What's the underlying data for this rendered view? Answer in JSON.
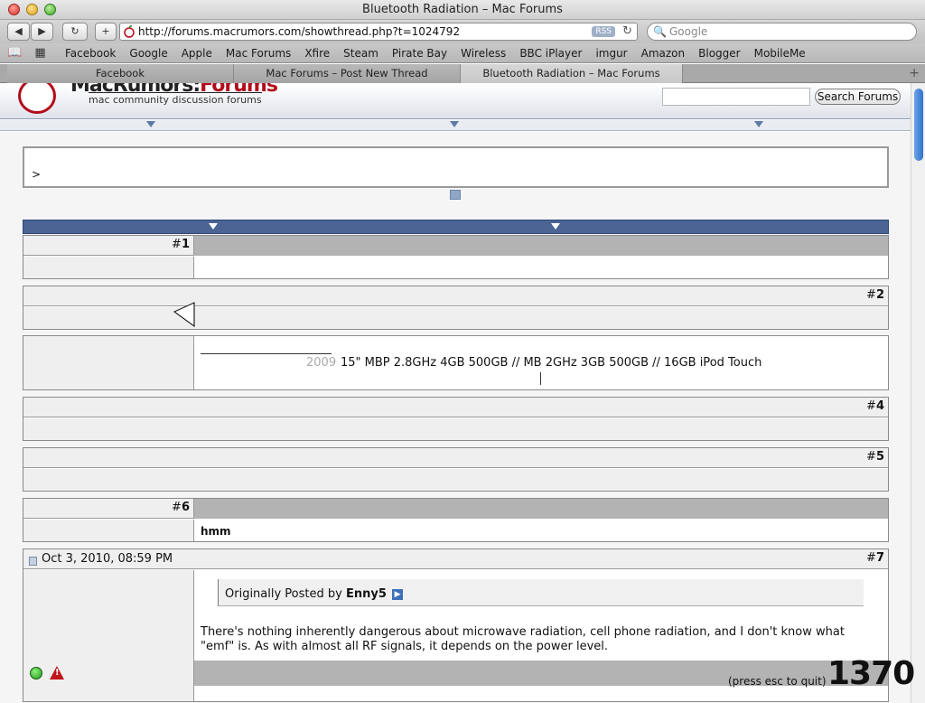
{
  "window": {
    "title": "Bluetooth Radiation – Mac Forums"
  },
  "toolbar": {
    "back_icon": "back-arrow-icon",
    "forward_icon": "forward-arrow-icon",
    "url": "http://forums.macrumors.com/showthread.php?t=1024792",
    "rss_label": "RSS",
    "search_placeholder": "Google"
  },
  "bookmarks": [
    "Facebook",
    "Google",
    "Apple",
    "Mac Forums",
    "Xfire",
    "Steam",
    "Pirate Bay",
    "Wireless",
    "BBC iPlayer",
    "imgur",
    "Amazon",
    "Blogger",
    "MobileMe"
  ],
  "tabs": [
    {
      "label": "Facebook",
      "active": false
    },
    {
      "label": "Mac Forums – Post New Thread",
      "active": false
    },
    {
      "label": "Bluetooth Radiation – Mac Forums",
      "active": true
    }
  ],
  "site": {
    "logo_word": "MacRumors:",
    "logo_word_red": "Forums",
    "tagline": "mac community discussion forums",
    "search_button": "Search Forums"
  },
  "breadcrumb": {
    "text": ">"
  },
  "posts": {
    "p1": {
      "hash": "#",
      "num": "1"
    },
    "p2": {
      "hash": "#",
      "num": "2"
    },
    "p3": {
      "sig_year": "2009",
      "sig_text": "15\" MBP 2.8GHz 4GB 500GB // MB 2GHz 3GB 500GB // 16GB iPod Touch"
    },
    "p4": {
      "hash": "#",
      "num": "4"
    },
    "p5": {
      "hash": "#",
      "num": "5"
    },
    "p6": {
      "hash": "#",
      "num": "6",
      "body": "hmm"
    },
    "p7": {
      "hash": "#",
      "num": "7",
      "date": "Oct 3, 2010, 08:59 PM",
      "quote_prefix": "Originally Posted by",
      "quote_author": "Enny5",
      "body": "There's nothing inherently dangerous about microwave radiation, cell phone radiation, and I don't know what \"emf\" is. As with almost all RF signals, it depends on the power level."
    }
  },
  "overlay": {
    "press": "(press esc to quit)",
    "counter": "1370"
  }
}
